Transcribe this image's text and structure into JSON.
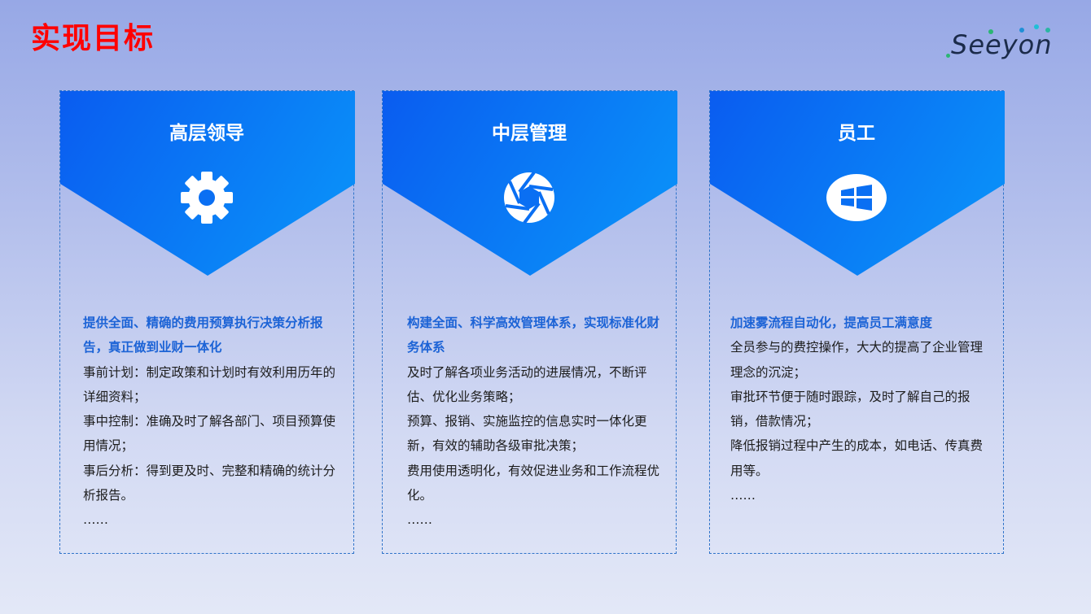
{
  "page": {
    "title": "实现目标"
  },
  "logo": {
    "text": "Seeyon"
  },
  "colors": {
    "title_red": "#ff0000",
    "card_blue_start": "#0a5cf0",
    "card_blue_end": "#0a8df8",
    "headline_blue": "#1c63d6",
    "border_blue": "#2f73c9"
  },
  "cards": [
    {
      "title": "高层领导",
      "icon": "gear-icon",
      "headline": "提供全面、精确的费用预算执行决策分析报告，真正做到业财一体化",
      "lines": [
        "事前计划：制定政策和计划时有效利用历年的详细资料；",
        "事中控制：准确及时了解各部门、项目预算使用情况；",
        "事后分析：得到更及时、完整和精确的统计分析报告。",
        "……"
      ]
    },
    {
      "title": "中层管理",
      "icon": "aperture-icon",
      "headline": "构建全面、科学高效管理体系，实现标准化财务体系",
      "lines": [
        "及时了解各项业务活动的进展情况，不断评估、优化业务策略；",
        "预算、报销、实施监控的信息实时一体化更新，有效的辅助各级审批决策；",
        "费用使用透明化，有效促进业务和工作流程优化。",
        "……"
      ]
    },
    {
      "title": "员工",
      "icon": "windows-icon",
      "headline": "加速雾流程自动化，提高员工满意度",
      "lines": [
        "全员参与的费控操作，大大的提高了企业管理理念的沉淀；",
        "审批环节便于随时跟踪，及时了解自己的报销，借款情况；",
        "降低报销过程中产生的成本，如电话、传真费用等。",
        "……"
      ]
    }
  ]
}
